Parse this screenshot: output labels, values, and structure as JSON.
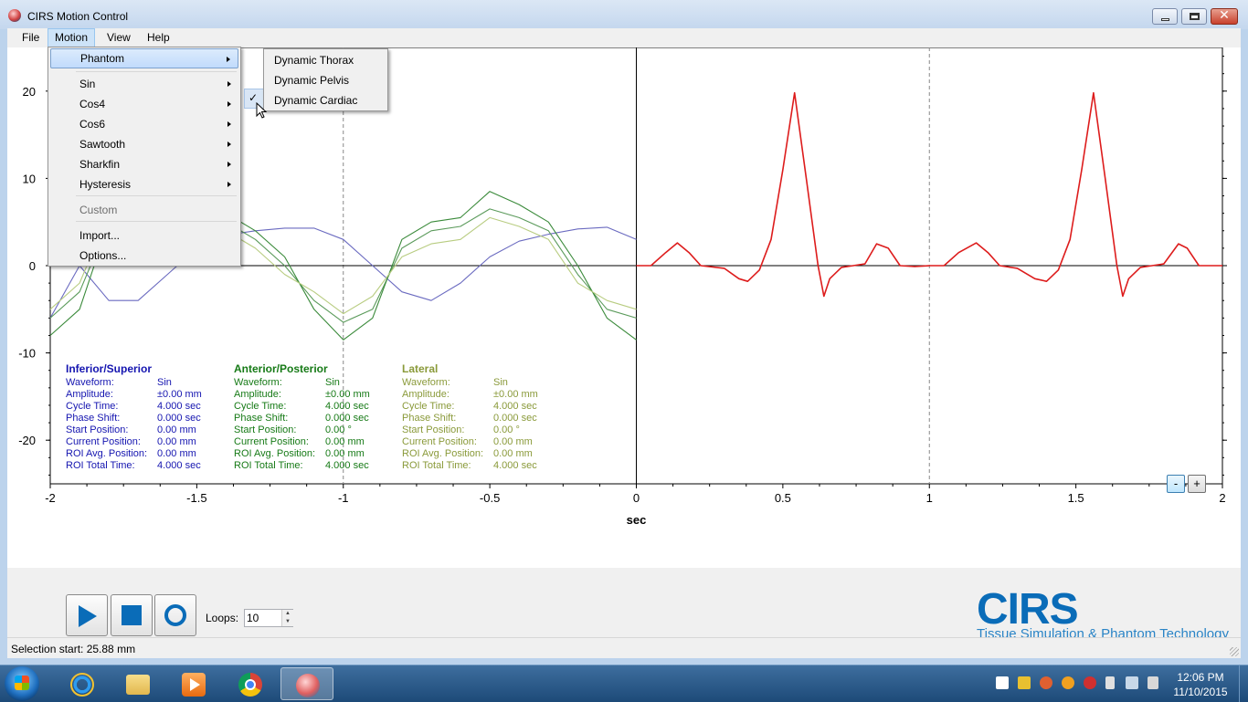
{
  "window": {
    "title": "CIRS Motion Control"
  },
  "menubar": {
    "file": "File",
    "motion": "Motion",
    "view": "View",
    "help": "Help"
  },
  "motion_menu": {
    "items": [
      {
        "label": "Phantom",
        "submenu": true,
        "highlighted": true
      },
      {
        "label": "Sin",
        "submenu": true
      },
      {
        "label": "Cos4",
        "submenu": true
      },
      {
        "label": "Cos6",
        "submenu": true
      },
      {
        "label": "Sawtooth",
        "submenu": true
      },
      {
        "label": "Sharkfin",
        "submenu": true
      },
      {
        "label": "Hysteresis",
        "submenu": true
      },
      {
        "label": "Custom",
        "disabled": true
      },
      {
        "label": "Import..."
      },
      {
        "label": "Options..."
      }
    ]
  },
  "phantom_submenu": {
    "items": [
      {
        "label": "Dynamic Thorax",
        "checked": false
      },
      {
        "label": "Dynamic Pelvis",
        "checked": false
      },
      {
        "label": "Dynamic Cardiac",
        "checked": true
      }
    ],
    "check_mark": "✓"
  },
  "chart_data": {
    "type": "line",
    "xlabel": "sec",
    "ylabel": "",
    "xlim": [
      -2,
      2
    ],
    "ylim": [
      -25,
      25
    ],
    "xticks": [
      "-2",
      "-1.5",
      "-1",
      "-0.5",
      "0",
      "0.5",
      "1",
      "1.5",
      "2"
    ],
    "yticks": [
      "20",
      "10",
      "0",
      "-10",
      "-20"
    ],
    "grid": "dashed vertical at x=-1 and x=1",
    "series": [
      {
        "color": "#6a6ac0",
        "x": [
          -2.0,
          -1.9,
          -1.8,
          -1.7,
          -1.6,
          -1.5,
          -1.4,
          -1.3,
          -1.2,
          -1.1,
          -1.0,
          -0.9,
          -0.8,
          -0.7,
          -0.6,
          -0.5,
          -0.4,
          -0.3,
          -0.2,
          -0.1,
          0.0
        ],
        "y": [
          -6,
          0,
          -4,
          -4,
          -1,
          2,
          3.5,
          4,
          4.3,
          4.3,
          3,
          0,
          -3,
          -4,
          -2,
          1,
          2.8,
          3.6,
          4.2,
          4.4,
          3
        ]
      },
      {
        "color": "#5a9a5a",
        "x": [
          -2.0,
          -1.9,
          -1.85,
          -1.7,
          -1.6,
          -1.5,
          -1.4,
          -1.3,
          -1.2,
          -1.1,
          -1.0,
          -0.9,
          -0.8,
          -0.7,
          -0.6,
          -0.5,
          -0.4,
          -0.3,
          -0.2,
          -0.1,
          0.0
        ],
        "y": [
          -6,
          -3,
          1,
          0,
          2,
          4,
          5,
          3,
          0,
          -4,
          -6.5,
          -5,
          2,
          4,
          4.5,
          6.5,
          5.5,
          4,
          -1,
          -5,
          -6
        ]
      },
      {
        "color": "#3a8a3a",
        "x": [
          -2.0,
          -1.9,
          -1.85,
          -1.7,
          -1.6,
          -1.5,
          -1.4,
          -1.3,
          -1.2,
          -1.1,
          -1.0,
          -0.9,
          -0.8,
          -0.7,
          -0.6,
          -0.5,
          -0.4,
          -0.3,
          -0.2,
          -0.1,
          0.0
        ],
        "y": [
          -8,
          -5,
          0,
          1,
          3,
          5,
          6,
          4,
          1,
          -5,
          -8.5,
          -6,
          3,
          5,
          5.5,
          8.5,
          7,
          5,
          0,
          -6,
          -8.5
        ]
      },
      {
        "color": "#b8cc80",
        "x": [
          -2.0,
          -1.9,
          -1.85,
          -1.7,
          -1.6,
          -1.5,
          -1.4,
          -1.3,
          -1.2,
          -1.1,
          -1.0,
          -0.9,
          -0.8,
          -0.7,
          -0.6,
          -0.5,
          -0.4,
          -0.3,
          -0.2,
          -0.1,
          0.0
        ],
        "y": [
          -5,
          -2,
          2,
          0,
          1.5,
          3,
          4,
          2,
          -1,
          -3,
          -5.5,
          -3.5,
          1,
          2.5,
          3,
          5.5,
          4.5,
          3,
          -2,
          -4,
          -5
        ]
      },
      {
        "color": "#dd1c1c",
        "x": [
          0.0,
          0.05,
          0.1,
          0.14,
          0.18,
          0.22,
          0.3,
          0.35,
          0.38,
          0.42,
          0.46,
          0.5,
          0.54,
          0.58,
          0.62,
          0.64,
          0.66,
          0.7,
          0.74,
          0.78,
          0.82,
          0.86,
          0.9,
          0.95,
          1.0,
          1.05,
          1.1,
          1.16,
          1.2,
          1.24,
          1.3,
          1.36,
          1.4,
          1.44,
          1.48,
          1.52,
          1.56,
          1.6,
          1.64,
          1.66,
          1.68,
          1.72,
          1.76,
          1.8,
          1.85,
          1.88,
          1.92,
          2.0
        ],
        "y": [
          0,
          0,
          1.5,
          2.6,
          1.5,
          0,
          -0.3,
          -1.5,
          -1.8,
          -0.5,
          3,
          11,
          19.8,
          10,
          0,
          -3.5,
          -1.5,
          -0.2,
          0,
          0.2,
          2.5,
          2,
          0,
          -0.1,
          0,
          0,
          1.5,
          2.6,
          1.5,
          0,
          -0.3,
          -1.5,
          -1.8,
          -0.5,
          3,
          11,
          19.8,
          10,
          0,
          -3.5,
          -1.5,
          -0.2,
          0,
          0.2,
          2.5,
          2,
          0,
          0
        ]
      }
    ]
  },
  "info_panels": [
    {
      "title": "Inferior/Superior",
      "color": "#1515b0",
      "rows": [
        {
          "label": "Waveform:",
          "value": "Sin"
        },
        {
          "label": "Amplitude:",
          "value": "±0.00 mm"
        },
        {
          "label": "Cycle Time:",
          "value": "4.000 sec"
        },
        {
          "label": "Phase Shift:",
          "value": "0.000 sec"
        },
        {
          "label": "Start Position:",
          "value": "0.00 mm"
        },
        {
          "label": "Current Position:",
          "value": "0.00 mm"
        },
        {
          "label": "ROI Avg. Position:",
          "value": "0.00 mm"
        },
        {
          "label": "ROI Total Time:",
          "value": "4.000 sec"
        }
      ]
    },
    {
      "title": "Anterior/Posterior",
      "color": "#167a16",
      "rows": [
        {
          "label": "Waveform:",
          "value": "Sin"
        },
        {
          "label": "Amplitude:",
          "value": "±0.00 mm"
        },
        {
          "label": "Cycle Time:",
          "value": "4.000 sec"
        },
        {
          "label": "Phase Shift:",
          "value": "0.000 sec"
        },
        {
          "label": "Start Position:",
          "value": "0.00 °"
        },
        {
          "label": "Current Position:",
          "value": "0.00 mm"
        },
        {
          "label": "ROI Avg. Position:",
          "value": "0.00 mm"
        },
        {
          "label": "ROI Total Time:",
          "value": "4.000 sec"
        }
      ]
    },
    {
      "title": "Lateral",
      "color": "#8a9a3a",
      "rows": [
        {
          "label": "Waveform:",
          "value": "Sin"
        },
        {
          "label": "Amplitude:",
          "value": "±0.00 mm"
        },
        {
          "label": "Cycle Time:",
          "value": "4.000 sec"
        },
        {
          "label": "Phase Shift:",
          "value": "0.000 sec"
        },
        {
          "label": "Start Position:",
          "value": "0.00 °"
        },
        {
          "label": "Current Position:",
          "value": "0.00 mm"
        },
        {
          "label": "ROI Avg. Position:",
          "value": "0.00 mm"
        },
        {
          "label": "ROI Total Time:",
          "value": "4.000 sec"
        }
      ]
    }
  ],
  "zoom": {
    "minus": "-",
    "plus": "+"
  },
  "controls": {
    "loops_label": "Loops:",
    "loops_value": "10",
    "spin_up": "▲",
    "spin_down": "▼"
  },
  "logo": {
    "text": "CIRS",
    "tagline": "Tissue Simulation & Phantom Technology"
  },
  "status": {
    "text": "Selection start: 25.88 mm"
  },
  "taskbar": {
    "apps": [
      "internet-explorer-icon",
      "file-explorer-icon",
      "media-player-icon",
      "chrome-icon",
      "cirs-app-icon"
    ],
    "clock_time": "12:06 PM",
    "clock_date": "11/10/2015"
  }
}
